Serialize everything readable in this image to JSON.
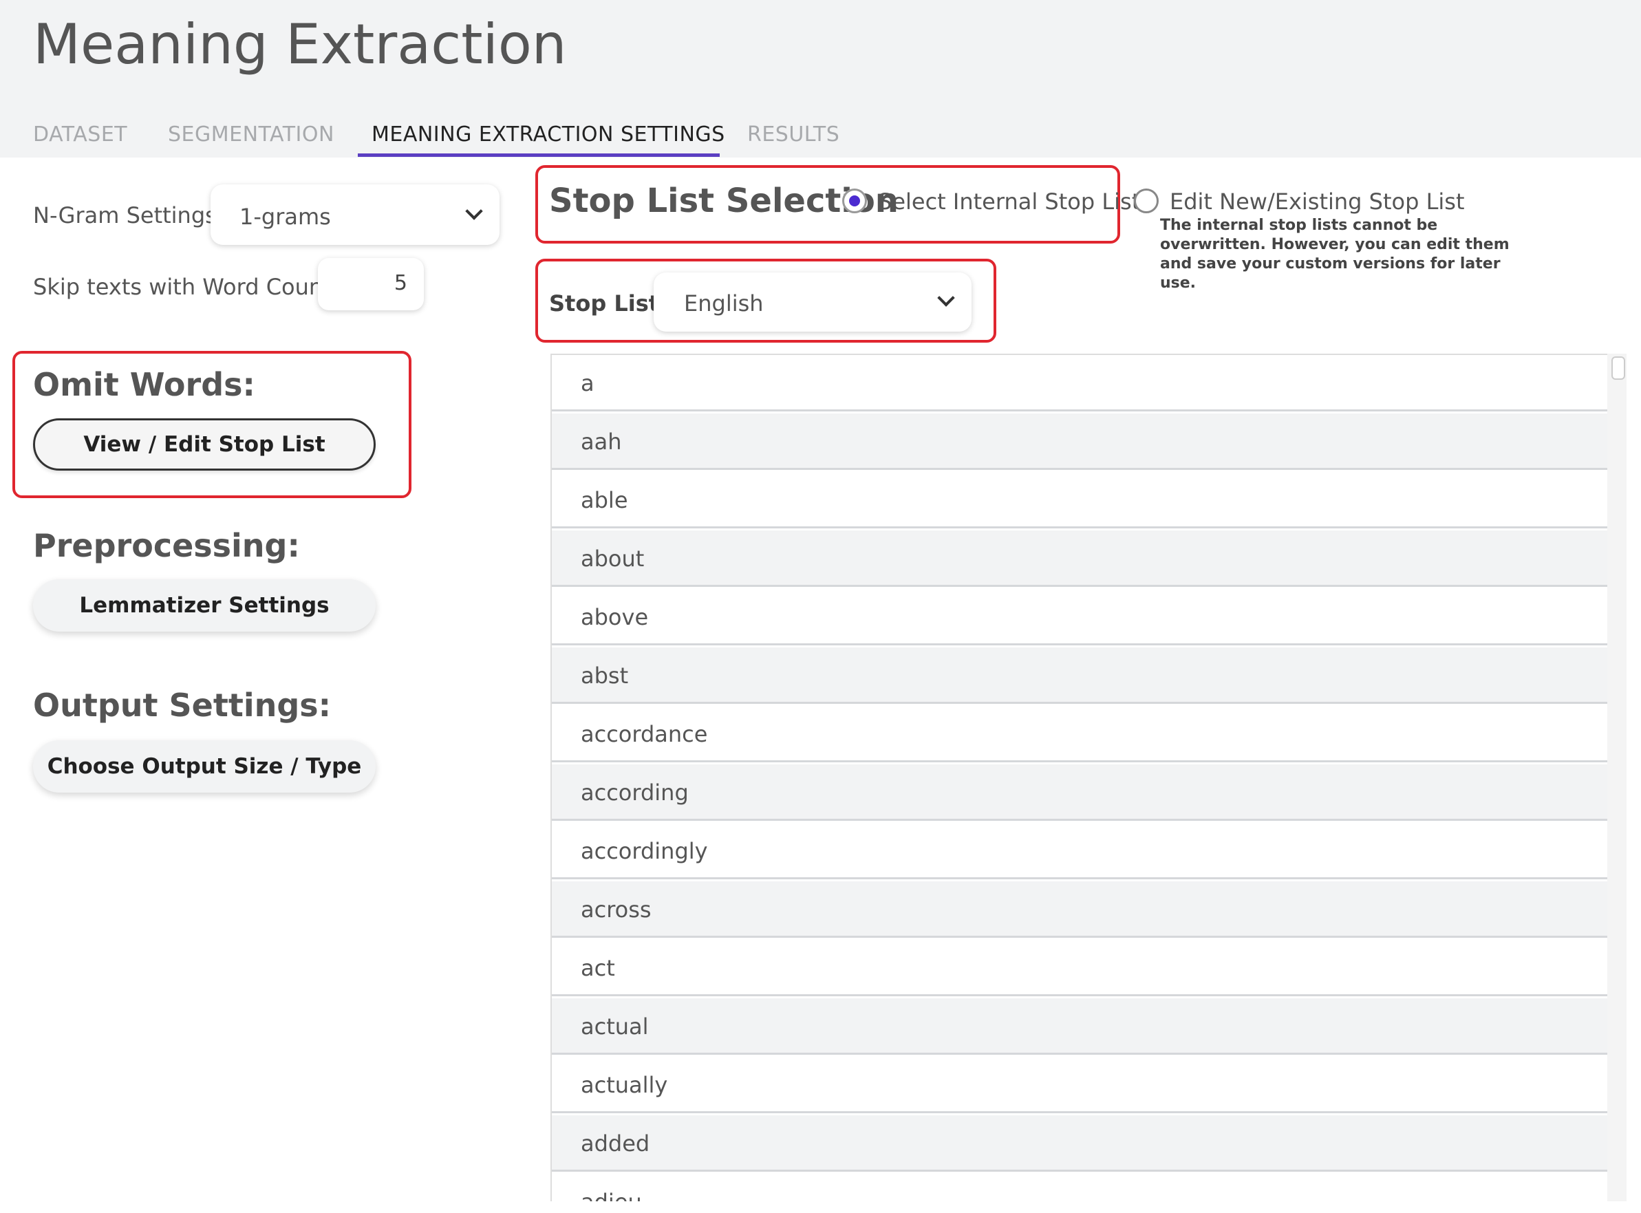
{
  "app": {
    "title": "Meaning Extraction"
  },
  "tabs": [
    {
      "label": "DATASET"
    },
    {
      "label": "SEGMENTATION"
    },
    {
      "label": "MEANING EXTRACTION SETTINGS",
      "active": true
    },
    {
      "label": "RESULTS"
    }
  ],
  "settings": {
    "ngram_label": "N-Gram Settings:",
    "ngram_value": "1-grams",
    "skip_label": "Skip texts with Word Count <",
    "skip_value": "5"
  },
  "omit": {
    "title": "Omit Words:",
    "button": "View / Edit Stop List"
  },
  "preprocessing": {
    "title": "Preprocessing:",
    "button": "Lemmatizer Settings"
  },
  "output": {
    "title": "Output Settings:",
    "button": "Choose Output Size / Type"
  },
  "stoplist": {
    "title": "Stop List Selection",
    "option_internal": "Select Internal Stop List",
    "option_edit": "Edit New/Existing Stop List",
    "note": "The internal stop lists cannot be overwritten. However, you can edit them and save your custom versions for later use.",
    "list_label": "Stop List:",
    "list_value": "English",
    "words": [
      "a",
      "aah",
      "able",
      "about",
      "above",
      "abst",
      "accordance",
      "according",
      "accordingly",
      "across",
      "act",
      "actual",
      "actually",
      "added",
      "adieu"
    ]
  },
  "colors": {
    "accent": "#5b3fc2",
    "highlight": "#e0262f"
  }
}
